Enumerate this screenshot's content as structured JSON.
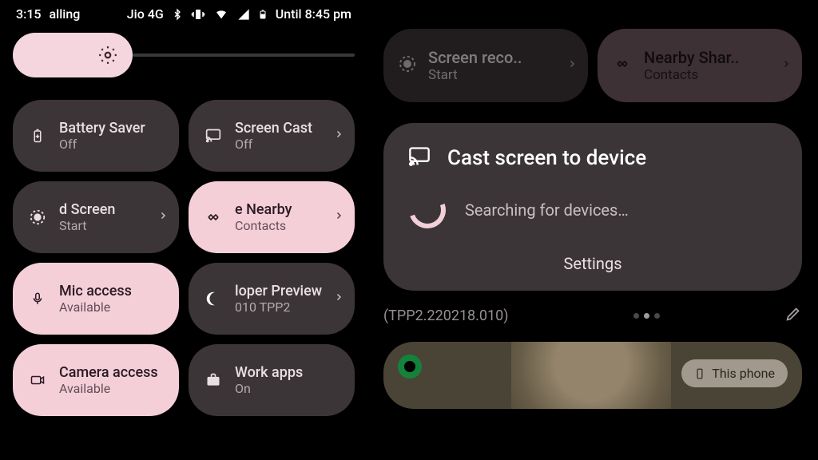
{
  "status_bar": {
    "time": "3:15",
    "label_left": "alling",
    "carrier": "Jio 4G",
    "battery_text": "Until 8:45 pm"
  },
  "left_panel": {
    "tiles": [
      {
        "title": "Battery Saver",
        "sub": "Off"
      },
      {
        "title": "Screen Cast",
        "sub": "Off"
      },
      {
        "title": "d      Screen",
        "sub": "Start"
      },
      {
        "title": "e      Nearby",
        "sub": "Contacts"
      },
      {
        "title": "Mic access",
        "sub": "Available"
      },
      {
        "title": "loper Preview",
        "sub": "010      TPP2"
      },
      {
        "title": "Camera access",
        "sub": "Available"
      },
      {
        "title": "Work apps",
        "sub": "On"
      }
    ]
  },
  "right_panel": {
    "top_tiles": [
      {
        "title": "Screen reco..",
        "sub": "Start"
      },
      {
        "title": "Nearby Shar..",
        "sub": "Contacts"
      }
    ],
    "cast": {
      "title": "Cast screen to device",
      "searching": "Searching for devices…",
      "settings": "Settings"
    },
    "build": "(TPP2.220218.010)",
    "media_chip": "This phone"
  }
}
